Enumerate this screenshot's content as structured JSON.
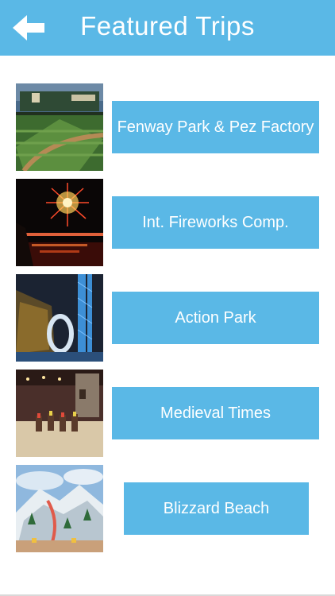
{
  "header": {
    "title": "Featured Trips",
    "back_icon": "back-arrow-icon"
  },
  "colors": {
    "accent": "#5ab8e6",
    "button_text": "#ffffff",
    "background": "#ffffff"
  },
  "trips": [
    {
      "label": "Fenway Park & Pez Factory",
      "image": "baseball-stadium-photo"
    },
    {
      "label": "Int. Fireworks Comp.",
      "image": "fireworks-photo"
    },
    {
      "label": "Action Park",
      "image": "waterslide-loop-photo"
    },
    {
      "label": "Medieval Times",
      "image": "jousting-arena-photo"
    },
    {
      "label": "Blizzard Beach",
      "image": "snowy-waterpark-photo"
    }
  ]
}
